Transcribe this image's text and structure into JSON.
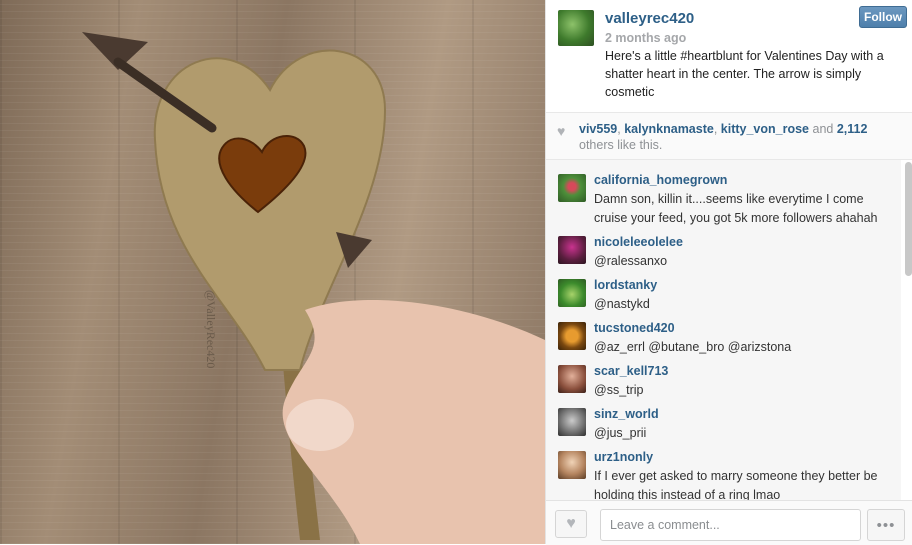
{
  "post": {
    "username": "valleyrec420",
    "time_ago": "2 months ago",
    "caption": "Here's a little #heartblunt       for Valentines Day with a shatter heart in the center. The arrow is simply cosmetic",
    "follow_label": "Follow",
    "photo_watermark": "@ValleyRec420"
  },
  "likes": {
    "users": [
      "viv559",
      "kalynknamaste",
      "kitty_von_rose"
    ],
    "separator": ", ",
    "and": " and ",
    "count": "2,112",
    "suffix": " others like this."
  },
  "comments": [
    {
      "user": "california_homegrown",
      "text": "Damn son, killin it....seems like everytime I come cruise your feed, you got 5k more followers ahahah"
    },
    {
      "user": "nicoleleeolelee",
      "text": "@ralessanxo"
    },
    {
      "user": "lordstanky",
      "text": "@nastykd"
    },
    {
      "user": "tucstoned420",
      "text": "@az_errl @butane_bro @arizstona"
    },
    {
      "user": "scar_kell713",
      "text": "@ss_trip"
    },
    {
      "user": "sinz_world",
      "text": "@jus_prii"
    },
    {
      "user": "urz1nonly",
      "text": "        If I ever get asked to marry someone they better be holding this instead of a ring lmao"
    }
  ],
  "footer": {
    "placeholder": "Leave a comment...",
    "more_icon": "ellipsis-icon",
    "like_icon": "heart-icon"
  },
  "colors": {
    "link": "#2d5f87",
    "follow_button": "#5a8ab5",
    "muted": "#a5a7aa"
  }
}
